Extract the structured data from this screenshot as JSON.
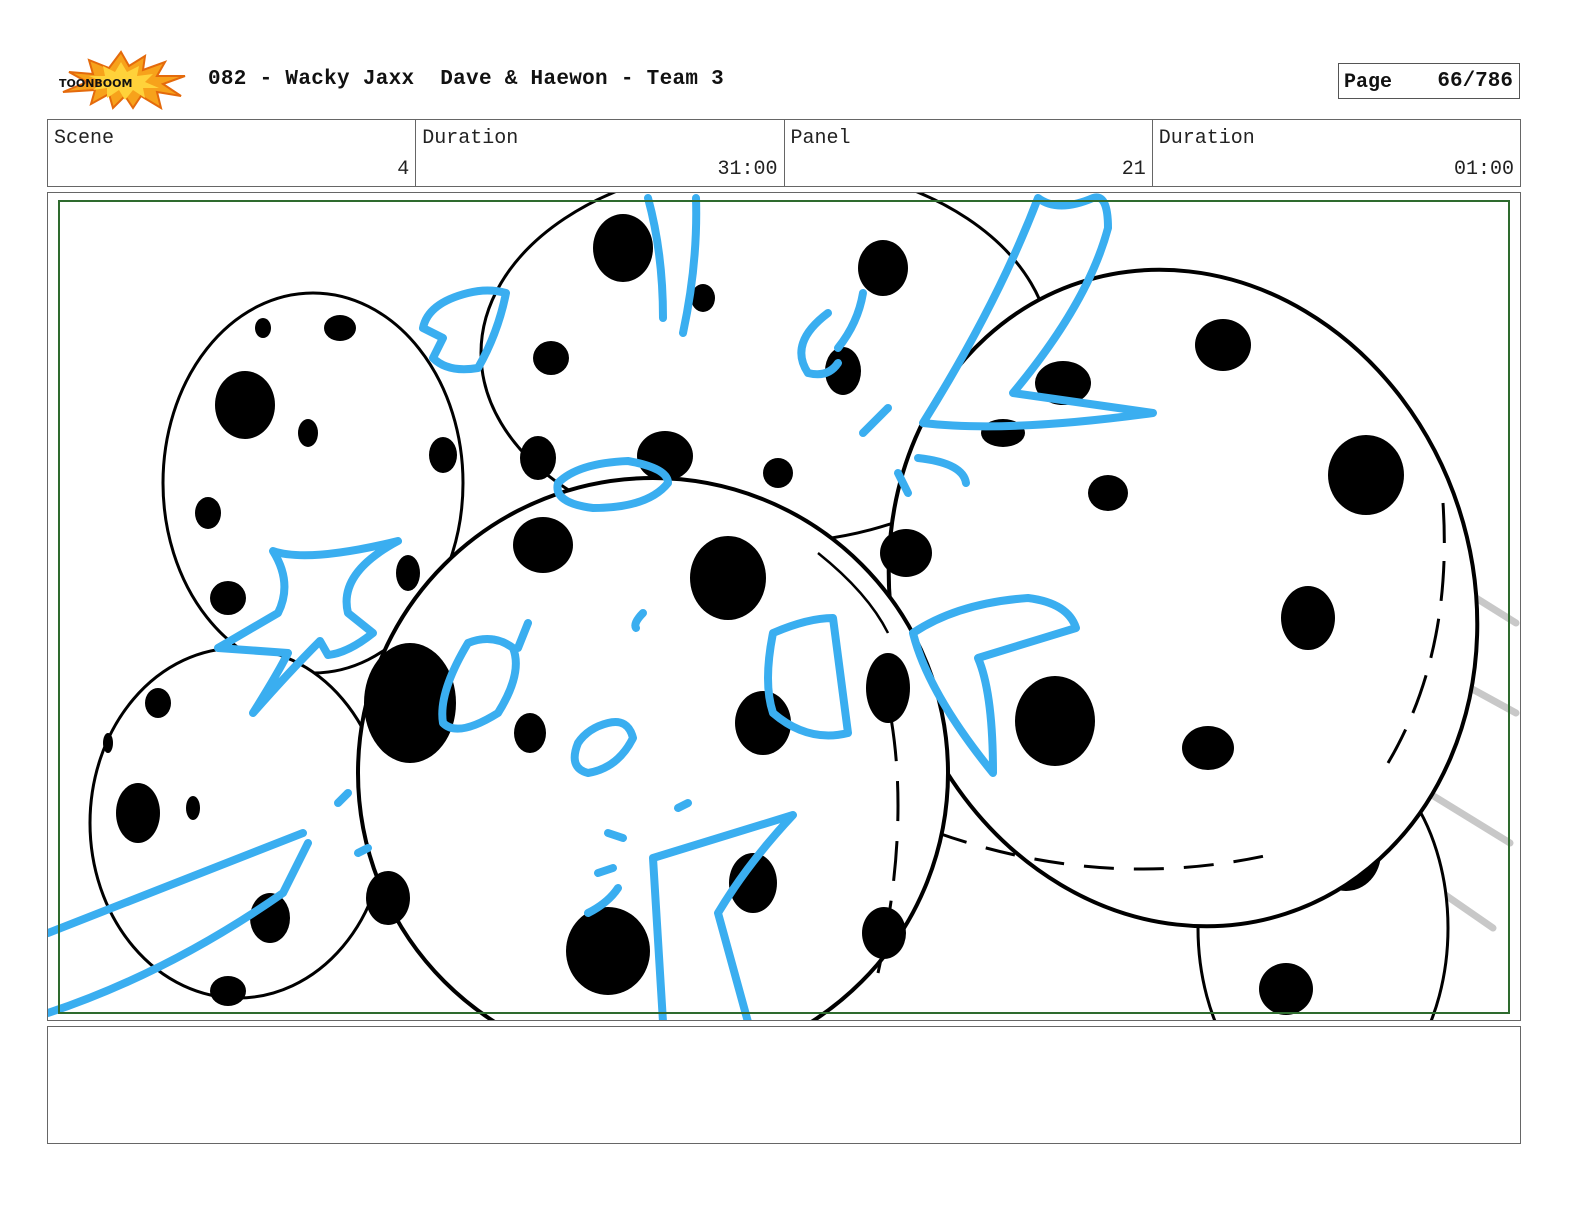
{
  "header": {
    "logo_text": "TOONBOOM",
    "title": "082 - Wacky Jaxx  Dave & Haewon - Team 3",
    "page_label": "Page",
    "page_value": "66/786"
  },
  "info": {
    "scene_label": "Scene",
    "scene_value": "4",
    "duration_label": "Duration",
    "duration_value": "31:00",
    "panel_label": "Panel",
    "panel_value": "21",
    "panel_duration_label": "Duration",
    "panel_duration_value": "01:00"
  },
  "panel": {
    "safe_frame_color": "#2e6b2e",
    "sketch_blue": "#3aaef0",
    "ink_color": "#000000",
    "motion_line_color": "#c8c8c8"
  },
  "notes": {}
}
